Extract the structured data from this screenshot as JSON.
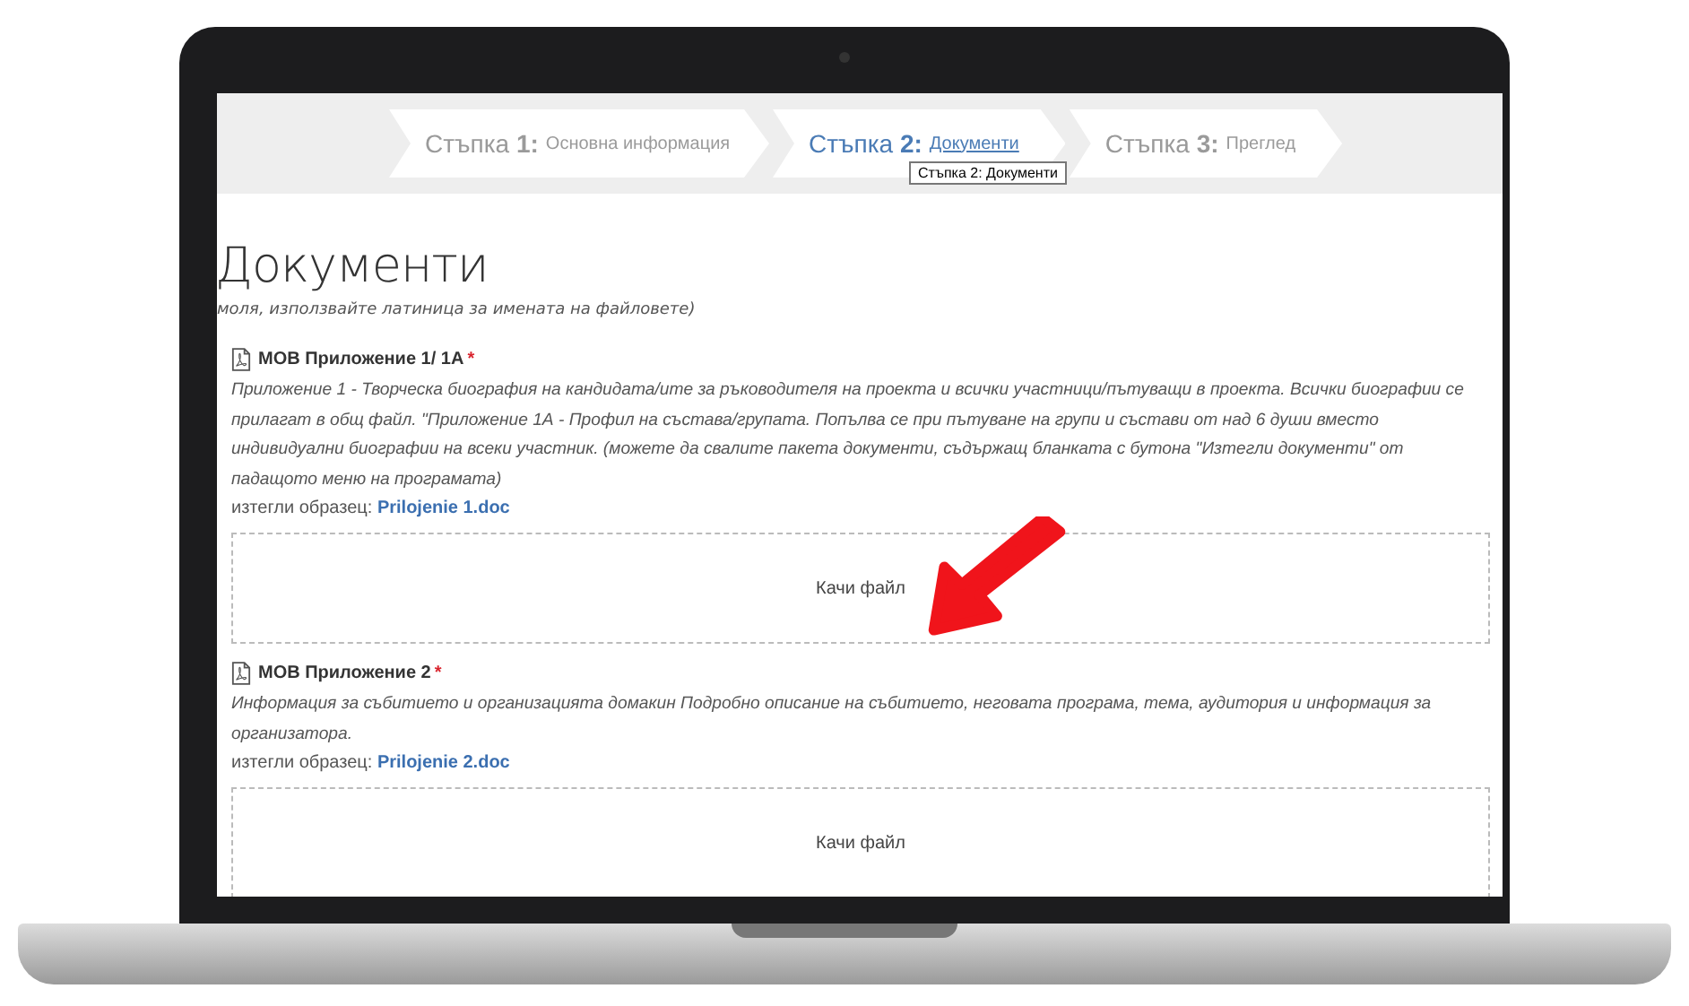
{
  "steps": [
    {
      "number": "Стъпка **1:**",
      "label": "Основна информация",
      "selected": false
    },
    {
      "number": "Стъпка **2:**",
      "label": "Документи",
      "selected": true
    },
    {
      "number": "Стъпка **3:**",
      "label": "Преглед",
      "selected": false
    }
  ],
  "tooltip": "Стъпка 2: Документи",
  "title": "Документи",
  "note": "моля, използвайте латиница за имената на файловете)",
  "documents": [
    {
      "name": "МОВ Приложение 1/ 1А",
      "required_mark": "*",
      "description": "Приложение 1 - Творческа биография на кандидата/ите за ръководителя на проекта и всички участници/пътуващи в проекта. Всички биографии се прилагат в общ файл. \"Приложение 1А - Профил на състава/групата. Попълва се при пътуване на групи и състави от над 6 души вместо индивидуални биографии на всеки участник. (можете да свалите пакета документи, съдържащ бланката с бутона \"Изтегли документи\" от падащото меню на програмата)",
      "download_label": "изтегли образец:",
      "file": "Prilojenie 1.doc",
      "upload": "Качи файл"
    },
    {
      "name": "МОВ Приложение 2",
      "required_mark": "*",
      "description": "Информация за събитието и организацията домакин Подробно описание на събитието, неговата програма, тема, аудитория и информация за организатора.",
      "download_label": "изтегли образец:",
      "file": "Prilojenie 2.doc",
      "upload": "Качи файл"
    }
  ]
}
